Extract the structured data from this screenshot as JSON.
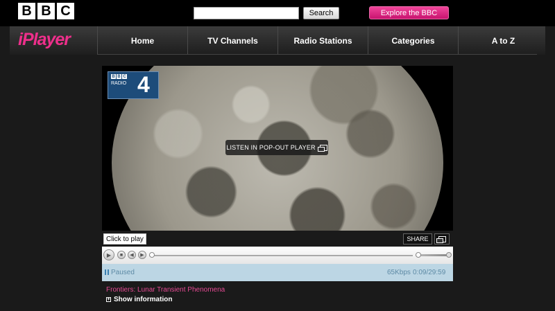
{
  "header": {
    "logo_letters": [
      "B",
      "B",
      "C"
    ],
    "search": {
      "value": "",
      "placeholder": ""
    },
    "search_label": "Search",
    "explore_label": "Explore the BBC"
  },
  "nav": {
    "logo_text": "iPlayer",
    "items": [
      {
        "label": "Home"
      },
      {
        "label": "TV Channels"
      },
      {
        "label": "Radio Stations"
      },
      {
        "label": "Categories"
      },
      {
        "label": "A to Z"
      }
    ]
  },
  "player": {
    "station": {
      "bbc": "BBC",
      "radio": "RADIO",
      "number": "4"
    },
    "popout_overlay_label": "LISTEN IN POP-OUT PLAYER",
    "tooltip": "Click to play",
    "share_label": "SHARE",
    "status": "Paused",
    "bitrate": "65Kbps",
    "time": "0:09/29:59",
    "progress_fraction": 0.005,
    "volume_fraction": 0.0
  },
  "programme": {
    "title": "Frontiers: Lunar Transient Phenomena",
    "show_info_label": "Show information"
  },
  "colors": {
    "accent_pink": "#e64a94",
    "explore_pink": "#d01a78",
    "status_bg": "#bcd6e4"
  }
}
